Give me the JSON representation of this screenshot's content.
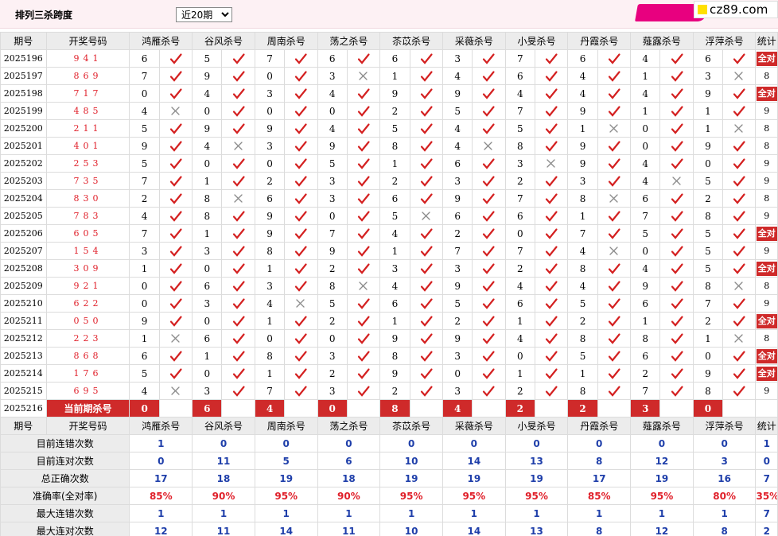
{
  "page": {
    "title": "排列三杀跨度",
    "period_select": "近20期",
    "logo_text": "cz89.com"
  },
  "colors": {
    "accent_red": "#cf2a2a",
    "draw_red": "#e0202a",
    "stat_blue": "#1f3faa",
    "header_gray": "#ececec"
  },
  "icons": {
    "right": "check-mark-icon",
    "wrong": "cross-mark-icon"
  },
  "table": {
    "headers": [
      "期号",
      "开奖号码",
      "鸿雁杀号",
      "谷风杀号",
      "周南杀号",
      "荡之杀号",
      "苶苡杀号",
      "采薇杀号",
      "小旻杀号",
      "丹霞杀号",
      "薤露杀号",
      "浮萍杀号",
      "统计"
    ],
    "all_right_label": "全对",
    "rows": [
      {
        "issue": "2025196",
        "draw": "941",
        "kills": [
          6,
          5,
          7,
          6,
          6,
          3,
          7,
          6,
          4,
          6
        ],
        "marks": [
          1,
          1,
          1,
          1,
          1,
          1,
          1,
          1,
          1,
          1
        ],
        "count": "全对"
      },
      {
        "issue": "2025197",
        "draw": "869",
        "kills": [
          7,
          9,
          0,
          3,
          1,
          4,
          6,
          4,
          1,
          3
        ],
        "marks": [
          1,
          1,
          1,
          0,
          1,
          1,
          1,
          1,
          1,
          0
        ],
        "count": "8"
      },
      {
        "issue": "2025198",
        "draw": "717",
        "kills": [
          0,
          4,
          3,
          4,
          9,
          9,
          4,
          4,
          4,
          9
        ],
        "marks": [
          1,
          1,
          1,
          1,
          1,
          1,
          1,
          1,
          1,
          1
        ],
        "count": "全对"
      },
      {
        "issue": "2025199",
        "draw": "485",
        "kills": [
          4,
          0,
          0,
          0,
          2,
          5,
          7,
          9,
          1,
          1
        ],
        "marks": [
          0,
          1,
          1,
          1,
          1,
          1,
          1,
          1,
          1,
          1
        ],
        "count": "9"
      },
      {
        "issue": "2025200",
        "draw": "211",
        "kills": [
          5,
          9,
          9,
          4,
          5,
          4,
          5,
          1,
          0,
          1
        ],
        "marks": [
          1,
          1,
          1,
          1,
          1,
          1,
          1,
          0,
          1,
          0
        ],
        "count": "8"
      },
      {
        "issue": "2025201",
        "draw": "401",
        "kills": [
          9,
          4,
          3,
          9,
          8,
          4,
          8,
          9,
          0,
          9
        ],
        "marks": [
          1,
          0,
          1,
          1,
          1,
          0,
          1,
          1,
          1,
          1
        ],
        "count": "8"
      },
      {
        "issue": "2025202",
        "draw": "253",
        "kills": [
          5,
          0,
          0,
          5,
          1,
          6,
          3,
          9,
          4,
          0
        ],
        "marks": [
          1,
          1,
          1,
          1,
          1,
          1,
          0,
          1,
          1,
          1
        ],
        "count": "9"
      },
      {
        "issue": "2025203",
        "draw": "735",
        "kills": [
          7,
          1,
          2,
          3,
          2,
          3,
          2,
          3,
          4,
          5
        ],
        "marks": [
          1,
          1,
          1,
          1,
          1,
          1,
          1,
          1,
          0,
          1
        ],
        "count": "9"
      },
      {
        "issue": "2025204",
        "draw": "830",
        "kills": [
          2,
          8,
          6,
          3,
          6,
          9,
          7,
          8,
          6,
          2
        ],
        "marks": [
          1,
          0,
          1,
          1,
          1,
          1,
          1,
          0,
          1,
          1
        ],
        "count": "8"
      },
      {
        "issue": "2025205",
        "draw": "783",
        "kills": [
          4,
          8,
          9,
          0,
          5,
          6,
          6,
          1,
          7,
          8
        ],
        "marks": [
          1,
          1,
          1,
          1,
          0,
          1,
          1,
          1,
          1,
          1
        ],
        "count": "9"
      },
      {
        "issue": "2025206",
        "draw": "605",
        "kills": [
          7,
          1,
          9,
          7,
          4,
          2,
          0,
          7,
          5,
          5
        ],
        "marks": [
          1,
          1,
          1,
          1,
          1,
          1,
          1,
          1,
          1,
          1
        ],
        "count": "全对"
      },
      {
        "issue": "2025207",
        "draw": "154",
        "kills": [
          3,
          3,
          8,
          9,
          1,
          7,
          7,
          4,
          0,
          5
        ],
        "marks": [
          1,
          1,
          1,
          1,
          1,
          1,
          1,
          0,
          1,
          1
        ],
        "count": "9"
      },
      {
        "issue": "2025208",
        "draw": "309",
        "kills": [
          1,
          0,
          1,
          2,
          3,
          3,
          2,
          8,
          4,
          5
        ],
        "marks": [
          1,
          1,
          1,
          1,
          1,
          1,
          1,
          1,
          1,
          1
        ],
        "count": "全对"
      },
      {
        "issue": "2025209",
        "draw": "921",
        "kills": [
          0,
          6,
          3,
          8,
          4,
          9,
          4,
          4,
          9,
          8
        ],
        "marks": [
          1,
          1,
          1,
          0,
          1,
          1,
          1,
          1,
          1,
          0
        ],
        "count": "8"
      },
      {
        "issue": "2025210",
        "draw": "622",
        "kills": [
          0,
          3,
          4,
          5,
          6,
          5,
          6,
          5,
          6,
          7
        ],
        "marks": [
          1,
          1,
          0,
          1,
          1,
          1,
          1,
          1,
          1,
          1
        ],
        "count": "9"
      },
      {
        "issue": "2025211",
        "draw": "050",
        "kills": [
          9,
          0,
          1,
          2,
          1,
          2,
          1,
          2,
          1,
          2
        ],
        "marks": [
          1,
          1,
          1,
          1,
          1,
          1,
          1,
          1,
          1,
          1
        ],
        "count": "全对"
      },
      {
        "issue": "2025212",
        "draw": "223",
        "kills": [
          1,
          6,
          0,
          0,
          9,
          9,
          4,
          8,
          8,
          1
        ],
        "marks": [
          0,
          1,
          1,
          1,
          1,
          1,
          1,
          1,
          1,
          0
        ],
        "count": "8"
      },
      {
        "issue": "2025213",
        "draw": "868",
        "kills": [
          6,
          1,
          8,
          3,
          8,
          3,
          0,
          5,
          6,
          0
        ],
        "marks": [
          1,
          1,
          1,
          1,
          1,
          1,
          1,
          1,
          1,
          1
        ],
        "count": "全对"
      },
      {
        "issue": "2025214",
        "draw": "176",
        "kills": [
          5,
          0,
          1,
          2,
          9,
          0,
          1,
          1,
          2,
          9
        ],
        "marks": [
          1,
          1,
          1,
          1,
          1,
          1,
          1,
          1,
          1,
          1
        ],
        "count": "全对"
      },
      {
        "issue": "2025215",
        "draw": "695",
        "kills": [
          4,
          3,
          7,
          3,
          2,
          3,
          2,
          8,
          7,
          8
        ],
        "marks": [
          0,
          1,
          1,
          1,
          1,
          1,
          1,
          1,
          1,
          1
        ],
        "count": "9"
      }
    ],
    "current": {
      "issue": "2025216",
      "label": "当前期杀号",
      "kills": [
        0,
        6,
        4,
        0,
        8,
        4,
        2,
        2,
        3,
        0
      ]
    }
  },
  "stats": {
    "headers": [
      "期号",
      "开奖号码",
      "鸿雁杀号",
      "谷风杀号",
      "周南杀号",
      "荡之杀号",
      "苶苡杀号",
      "采薇杀号",
      "小旻杀号",
      "丹霞杀号",
      "薤露杀号",
      "浮萍杀号",
      "统计"
    ],
    "rows": [
      {
        "label": "目前连错次数",
        "values": [
          "1",
          "0",
          "0",
          "0",
          "0",
          "0",
          "0",
          "0",
          "0",
          "0",
          "1"
        ],
        "kind": "num"
      },
      {
        "label": "目前连对次数",
        "values": [
          "0",
          "11",
          "5",
          "6",
          "10",
          "14",
          "13",
          "8",
          "12",
          "3",
          "0"
        ],
        "kind": "num"
      },
      {
        "label": "总正确次数",
        "values": [
          "17",
          "18",
          "19",
          "18",
          "19",
          "19",
          "19",
          "17",
          "19",
          "16",
          "7"
        ],
        "kind": "num"
      },
      {
        "label": "准确率(全对率)",
        "values": [
          "85%",
          "90%",
          "95%",
          "90%",
          "95%",
          "95%",
          "95%",
          "85%",
          "95%",
          "80%",
          "35%"
        ],
        "kind": "pct"
      },
      {
        "label": "最大连错次数",
        "values": [
          "1",
          "1",
          "1",
          "1",
          "1",
          "1",
          "1",
          "1",
          "1",
          "1",
          "7"
        ],
        "kind": "num"
      },
      {
        "label": "最大连对次数",
        "values": [
          "12",
          "11",
          "14",
          "11",
          "10",
          "14",
          "13",
          "8",
          "12",
          "8",
          "2"
        ],
        "kind": "num"
      }
    ]
  }
}
